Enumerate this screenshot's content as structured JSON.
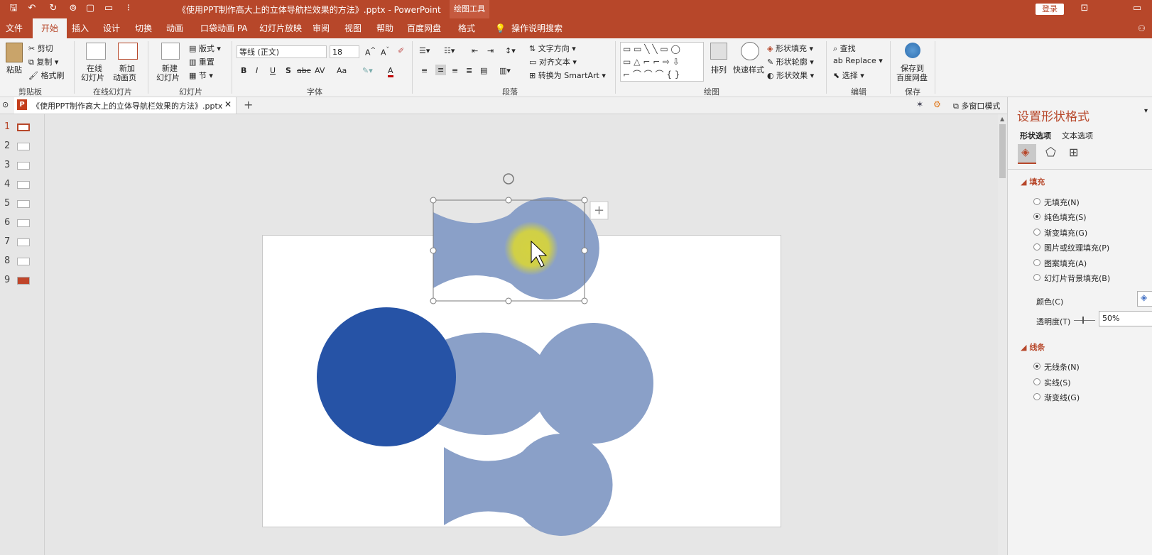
{
  "app": {
    "title": "《使用PPT制作高大上的立体导航栏效果的方法》.pptx  -  PowerPoint",
    "context_tab_group": "绘图工具",
    "login_label": "登录"
  },
  "tabs": [
    "文件",
    "开始",
    "插入",
    "设计",
    "切换",
    "动画",
    "口袋动画 PA",
    "幻灯片放映",
    "审阅",
    "视图",
    "帮助",
    "百度网盘",
    "格式"
  ],
  "active_tab": "开始",
  "tell_me": "操作说明搜索",
  "ribbon": {
    "clipboard": {
      "paste": "粘贴",
      "cut": "剪切",
      "copy": "复制",
      "format_painter": "格式刷",
      "label": "剪贴板"
    },
    "online_slides": {
      "online": "在线\n幻灯片",
      "online_a": "在线",
      "online_b": "幻灯片",
      "new_anim_a": "新加",
      "new_anim_b": "动画页",
      "label": "在线幻灯片"
    },
    "slides": {
      "new_a": "新建",
      "new_b": "幻灯片",
      "layout": "版式",
      "reset": "重置",
      "section": "节",
      "label": "幻灯片"
    },
    "font": {
      "name": "等线 (正文)",
      "size": "18",
      "bold": "B",
      "italic": "I",
      "underline": "U",
      "shadow": "S",
      "strike": "abc",
      "spacing": "AV",
      "case": "Aa",
      "color_a": "A",
      "label": "字体"
    },
    "paragraph": {
      "text_dir": "文字方向",
      "align_text": "对齐文本",
      "smartart": "转换为 SmartArt",
      "label": "段落"
    },
    "drawing": {
      "arrange": "排列",
      "quick_styles": "快速样式",
      "fill": "形状填充",
      "outline": "形状轮廓",
      "effects": "形状效果",
      "label": "绘图"
    },
    "editing": {
      "find": "查找",
      "replace": "Replace",
      "select": "选择",
      "label": "编辑"
    },
    "save": {
      "save_a": "保存到",
      "save_b": "百度网盘",
      "label": "保存"
    }
  },
  "doc_tab": "《使用PPT制作高大上的立体导航栏效果的方法》.pptx",
  "multi_window": "多窗口模式",
  "slides_panel": [
    "1",
    "2",
    "3",
    "4",
    "5",
    "6",
    "7",
    "8",
    "9"
  ],
  "format_pane": {
    "title": "设置形状格式",
    "tab_shape": "形状选项",
    "tab_text": "文本选项",
    "fill_heading": "填充",
    "fill_options": [
      "无填充(N)",
      "纯色填充(S)",
      "渐变填充(G)",
      "图片或纹理填充(P)",
      "图案填充(A)",
      "幻灯片背景填充(B)"
    ],
    "fill_selected": 1,
    "color_label": "颜色(C)",
    "transparency_label": "透明度(T)",
    "transparency_value": "50%",
    "line_heading": "线条",
    "line_options": [
      "无线条(N)",
      "实线(S)",
      "渐变线(G)"
    ],
    "line_selected": 0
  },
  "colors": {
    "accent": "#b7472a",
    "shape_blue": "#2653a6",
    "shape_light": "#8aa0c8",
    "cursor_glow": "#d4d240"
  }
}
